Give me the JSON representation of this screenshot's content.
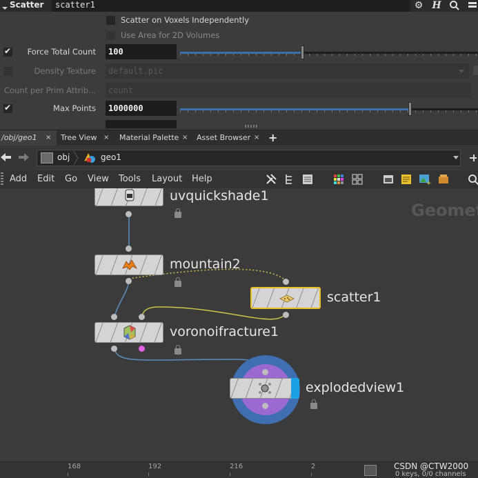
{
  "header": {
    "node_type": "Scatter",
    "node_name": "scatter1",
    "icons": [
      "gear-icon",
      "help-icon",
      "search-icon"
    ]
  },
  "params": {
    "scatter_voxels_label": "Scatter on Voxels Independently",
    "use_area_label": "Use Area for 2D Volumes",
    "force_total_count": {
      "label": "Force Total Count",
      "checked": true,
      "value": "100",
      "slider_fraction": 0.41
    },
    "density_texture": {
      "label": "Density Texture",
      "checked": false,
      "value": "default.pic"
    },
    "count_per_prim": {
      "label": "Count per Prim Attrib...",
      "value": "count"
    },
    "max_points": {
      "label": "Max Points",
      "checked": true,
      "value": "1000000",
      "slider_fraction": 0.77
    }
  },
  "tabs": [
    {
      "label": "/obj/geo1",
      "active": true
    },
    {
      "label": "Tree View",
      "active": false
    },
    {
      "label": "Material Palette",
      "active": false
    },
    {
      "label": "Asset Browser",
      "active": false
    }
  ],
  "tab_close_glyph": "×",
  "tab_add_glyph": "+",
  "path": {
    "crumb1": "obj",
    "crumb2": "geo1"
  },
  "menu": [
    "Add",
    "Edit",
    "Go",
    "View",
    "Tools",
    "Layout",
    "Help"
  ],
  "network": {
    "watermark": "Geomet",
    "nodes": [
      {
        "name": "uvquickshade1"
      },
      {
        "name": "mountain2"
      },
      {
        "name": "scatter1"
      },
      {
        "name": "voronoifracture1"
      },
      {
        "name": "explodedview1"
      }
    ],
    "colors": {
      "selected_outline": "#e8c020",
      "wire_yellow": "#c8c84a",
      "wire_blue": "#5a8fc0",
      "explode_ring": "#3f6fb0",
      "explode_inner": "#9a6ad0",
      "display_flag": "#1ea0e6",
      "pink_output": "#e060e0"
    }
  },
  "timeline": {
    "frames": [
      "168",
      "192",
      "216",
      "2"
    ],
    "status": "0 keys, 0/0 channels"
  },
  "credit": "CSDN @CTW2000"
}
